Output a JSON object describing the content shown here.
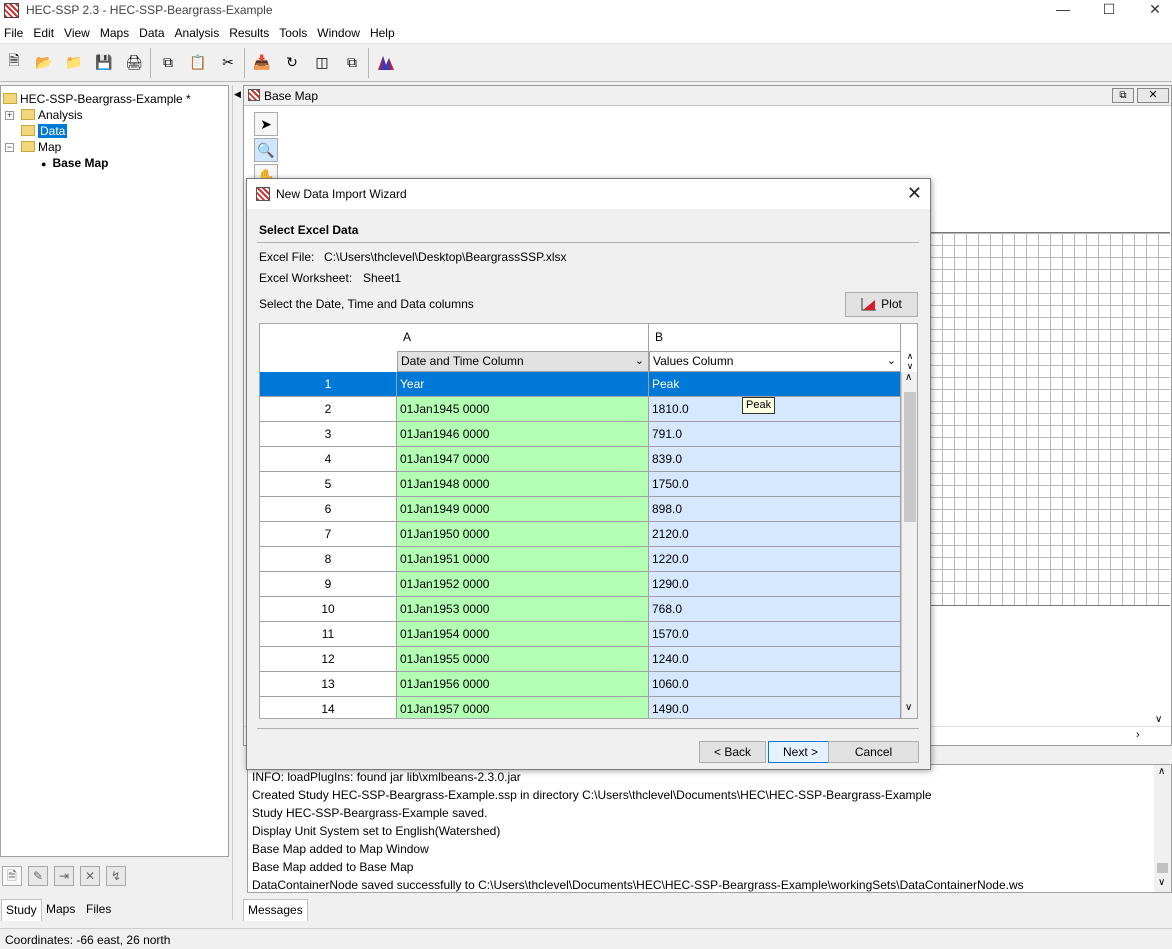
{
  "window": {
    "title": "HEC-SSP 2.3 - HEC-SSP-Beargrass-Example"
  },
  "menu": [
    "File",
    "Edit",
    "View",
    "Maps",
    "Data",
    "Analysis",
    "Results",
    "Tools",
    "Window",
    "Help"
  ],
  "tree": {
    "root": "HEC-SSP-Beargrass-Example *",
    "analysis": "Analysis",
    "data": "Data",
    "map": "Map",
    "base_map": "Base Map"
  },
  "left_tabs": [
    "Study",
    "Maps",
    "Files"
  ],
  "map_window": {
    "title": "Base Map"
  },
  "dialog": {
    "title": "New Data Import Wizard",
    "section": "Select Excel Data",
    "excel_file_label": "Excel File:",
    "excel_file_value": "C:\\Users\\thclevel\\Desktop\\BeargrassSSP.xlsx",
    "worksheet_label": "Excel Worksheet:",
    "worksheet_value": "Sheet1",
    "instruction": "Select the Date, Time and Data columns",
    "plot_button": "Plot",
    "col_a": "A",
    "col_b": "B",
    "col_a_type": "Date and Time Column",
    "col_b_type": "Values Column",
    "tooltip": "Peak",
    "back_button": "< Back",
    "next_button": "Next >",
    "cancel_button": "Cancel",
    "rows": [
      {
        "num": "1",
        "a": "Year",
        "b": "Peak"
      },
      {
        "num": "2",
        "a": "01Jan1945 0000",
        "b": "1810.0"
      },
      {
        "num": "3",
        "a": "01Jan1946 0000",
        "b": "791.0"
      },
      {
        "num": "4",
        "a": "01Jan1947 0000",
        "b": "839.0"
      },
      {
        "num": "5",
        "a": "01Jan1948 0000",
        "b": "1750.0"
      },
      {
        "num": "6",
        "a": "01Jan1949 0000",
        "b": "898.0"
      },
      {
        "num": "7",
        "a": "01Jan1950 0000",
        "b": "2120.0"
      },
      {
        "num": "8",
        "a": "01Jan1951 0000",
        "b": "1220.0"
      },
      {
        "num": "9",
        "a": "01Jan1952 0000",
        "b": "1290.0"
      },
      {
        "num": "10",
        "a": "01Jan1953 0000",
        "b": "768.0"
      },
      {
        "num": "11",
        "a": "01Jan1954 0000",
        "b": "1570.0"
      },
      {
        "num": "12",
        "a": "01Jan1955 0000",
        "b": "1240.0"
      },
      {
        "num": "13",
        "a": "01Jan1956 0000",
        "b": "1060.0"
      },
      {
        "num": "14",
        "a": "01Jan1957 0000",
        "b": "1490.0"
      }
    ]
  },
  "messages": [
    "INFO: loadPlugIns: found jar lib\\xmlbeans-2.3.0.jar",
    "Created Study HEC-SSP-Beargrass-Example.ssp in directory C:\\Users\\thclevel\\Documents\\HEC\\HEC-SSP-Beargrass-Example",
    "Study HEC-SSP-Beargrass-Example saved.",
    "Display Unit System set to English(Watershed)",
    "Base Map added to Map Window",
    "Base Map added to Base Map",
    "DataContainerNode saved successfully to C:\\Users\\thclevel\\Documents\\HEC\\HEC-SSP-Beargrass-Example\\workingSets\\DataContainerNode.ws"
  ],
  "messages_tab": "Messages",
  "status": "Coordinates: -66 east, 26 north"
}
